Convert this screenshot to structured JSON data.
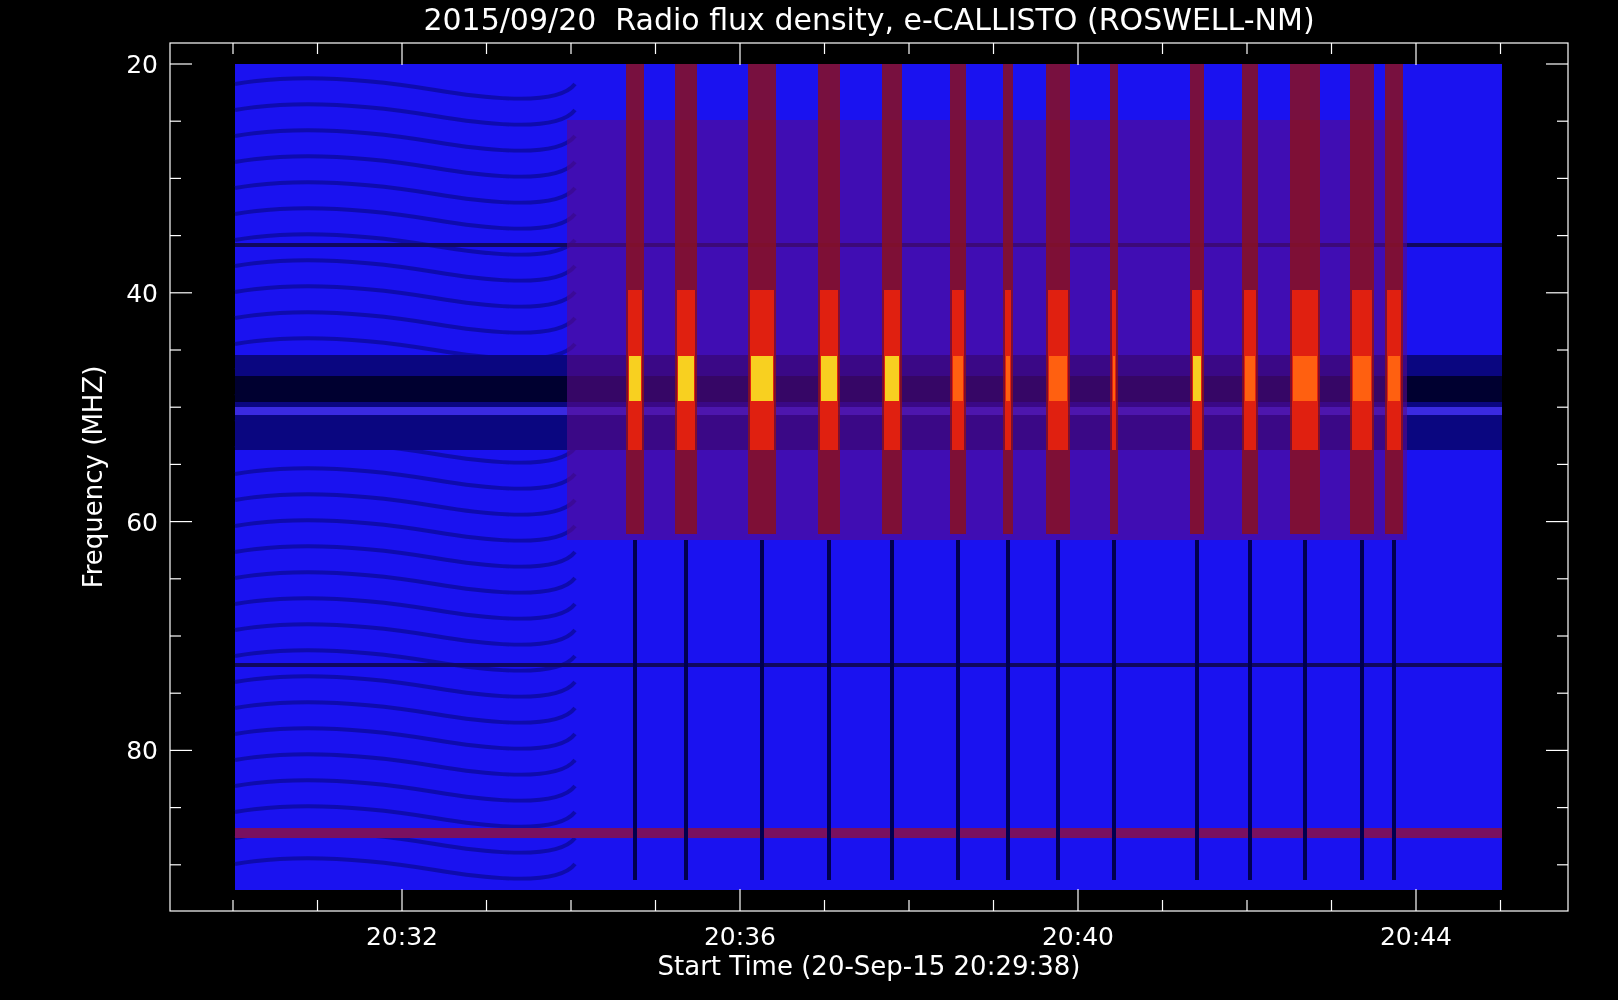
{
  "title": "2015/09/20  Radio flux density, e-CALLISTO (ROSWELL-NM)",
  "ylabel": "Frequency (MHZ)",
  "xlabel": "Start Time (20-Sep-15 20:29:38)",
  "y_tick_labels": [
    "20",
    "40",
    "60",
    "80"
  ],
  "x_tick_labels": [
    "20:32",
    "20:36",
    "20:40",
    "20:44"
  ]
}
